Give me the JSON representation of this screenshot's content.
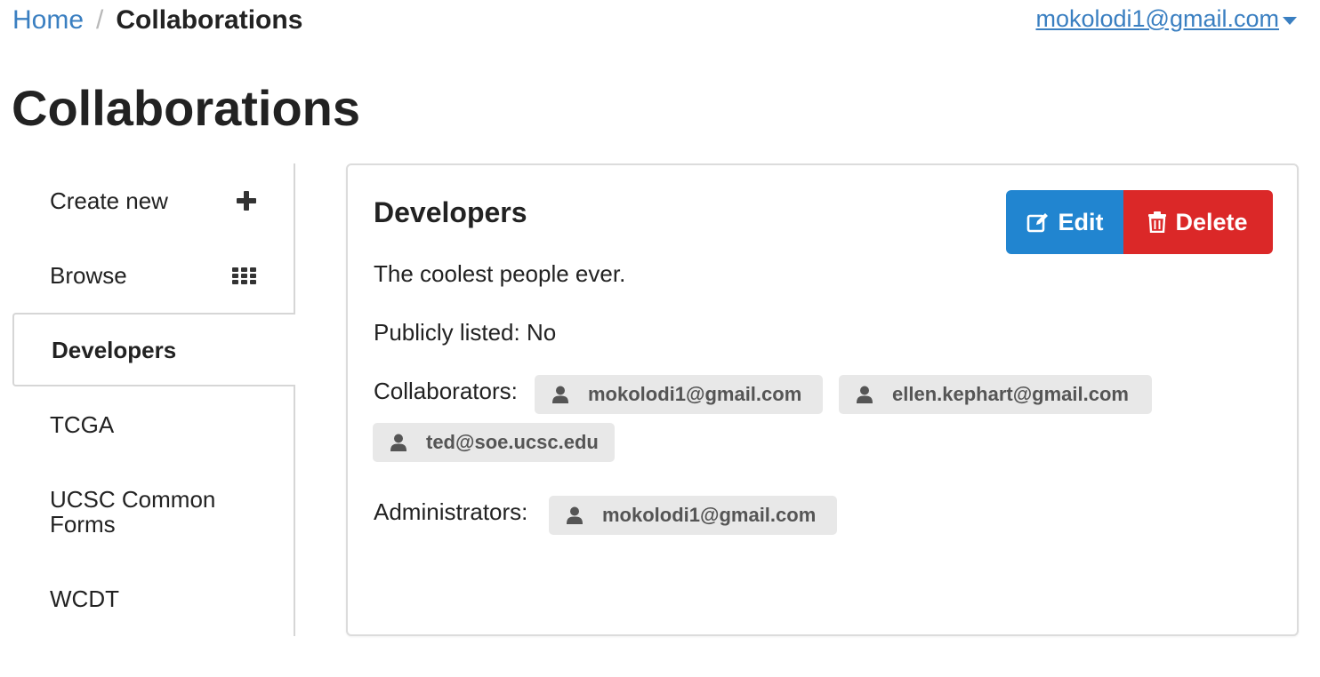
{
  "breadcrumb": {
    "home": "Home",
    "separator": "/",
    "current": "Collaborations"
  },
  "user_menu": {
    "email": "mokolodi1@gmail.com",
    "icon": "caret-down-icon"
  },
  "page": {
    "title": "Collaborations"
  },
  "sidebar": {
    "items": [
      {
        "label": "Create new",
        "icon": "plus-icon"
      },
      {
        "label": "Browse",
        "icon": "grid-icon"
      },
      {
        "label": "Developers",
        "active": true
      },
      {
        "label": "TCGA"
      },
      {
        "label": "UCSC Common Forms"
      },
      {
        "label": "WCDT"
      }
    ]
  },
  "collaboration": {
    "name": "Developers",
    "description": "The coolest people ever.",
    "publicly_listed": "Publicly listed: No",
    "collaborators_label": "Collaborators:",
    "collaborators": [
      "mokolodi1@gmail.com",
      "ellen.kephart@gmail.com",
      "ted@soe.ucsc.edu"
    ],
    "administrators_label": "Administrators:",
    "administrators": [
      "mokolodi1@gmail.com"
    ]
  },
  "actions": {
    "edit_label": "Edit",
    "delete_label": "Delete"
  },
  "colors": {
    "link": "#3a7fc1",
    "edit_button": "#2185d0",
    "delete_button": "#db2828",
    "chip_bg": "#e8e8e8"
  }
}
